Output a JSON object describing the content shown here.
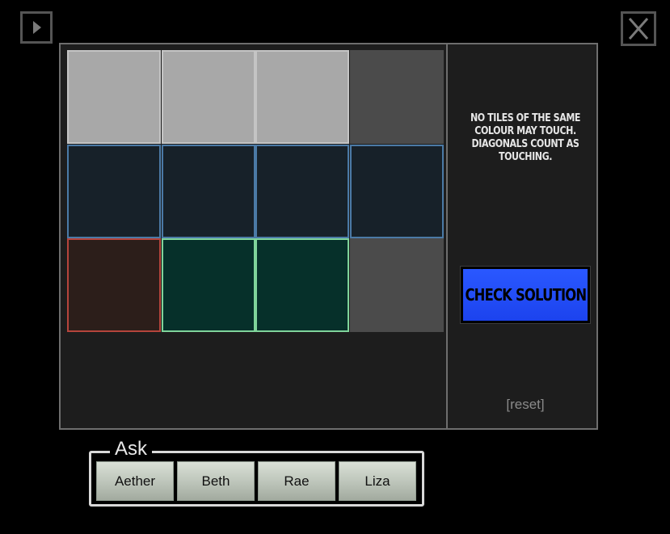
{
  "toolbar": {
    "play_icon": "play-triangle-icon",
    "close_icon": "close-x-icon"
  },
  "puzzle": {
    "instructions": "No tiles of the same colour may touch. Diagonals count as touching.",
    "check_label": "Check Solution",
    "reset_label": "[reset]",
    "tiles": [
      [
        "light",
        "light",
        "light",
        "dark"
      ],
      [
        "blue",
        "blue",
        "blue",
        "blue"
      ],
      [
        "red",
        "green",
        "green",
        "dark"
      ]
    ],
    "colors": {
      "light": "#a8a8a8",
      "dark": "#4b4b4b",
      "blue": "#4b7aa6",
      "red": "#b5443c",
      "green": "#7fd49b",
      "check_button": "#2a58ff"
    }
  },
  "ask": {
    "label": "Ask",
    "buttons": [
      "Aether",
      "Beth",
      "Rae",
      "Liza"
    ]
  }
}
